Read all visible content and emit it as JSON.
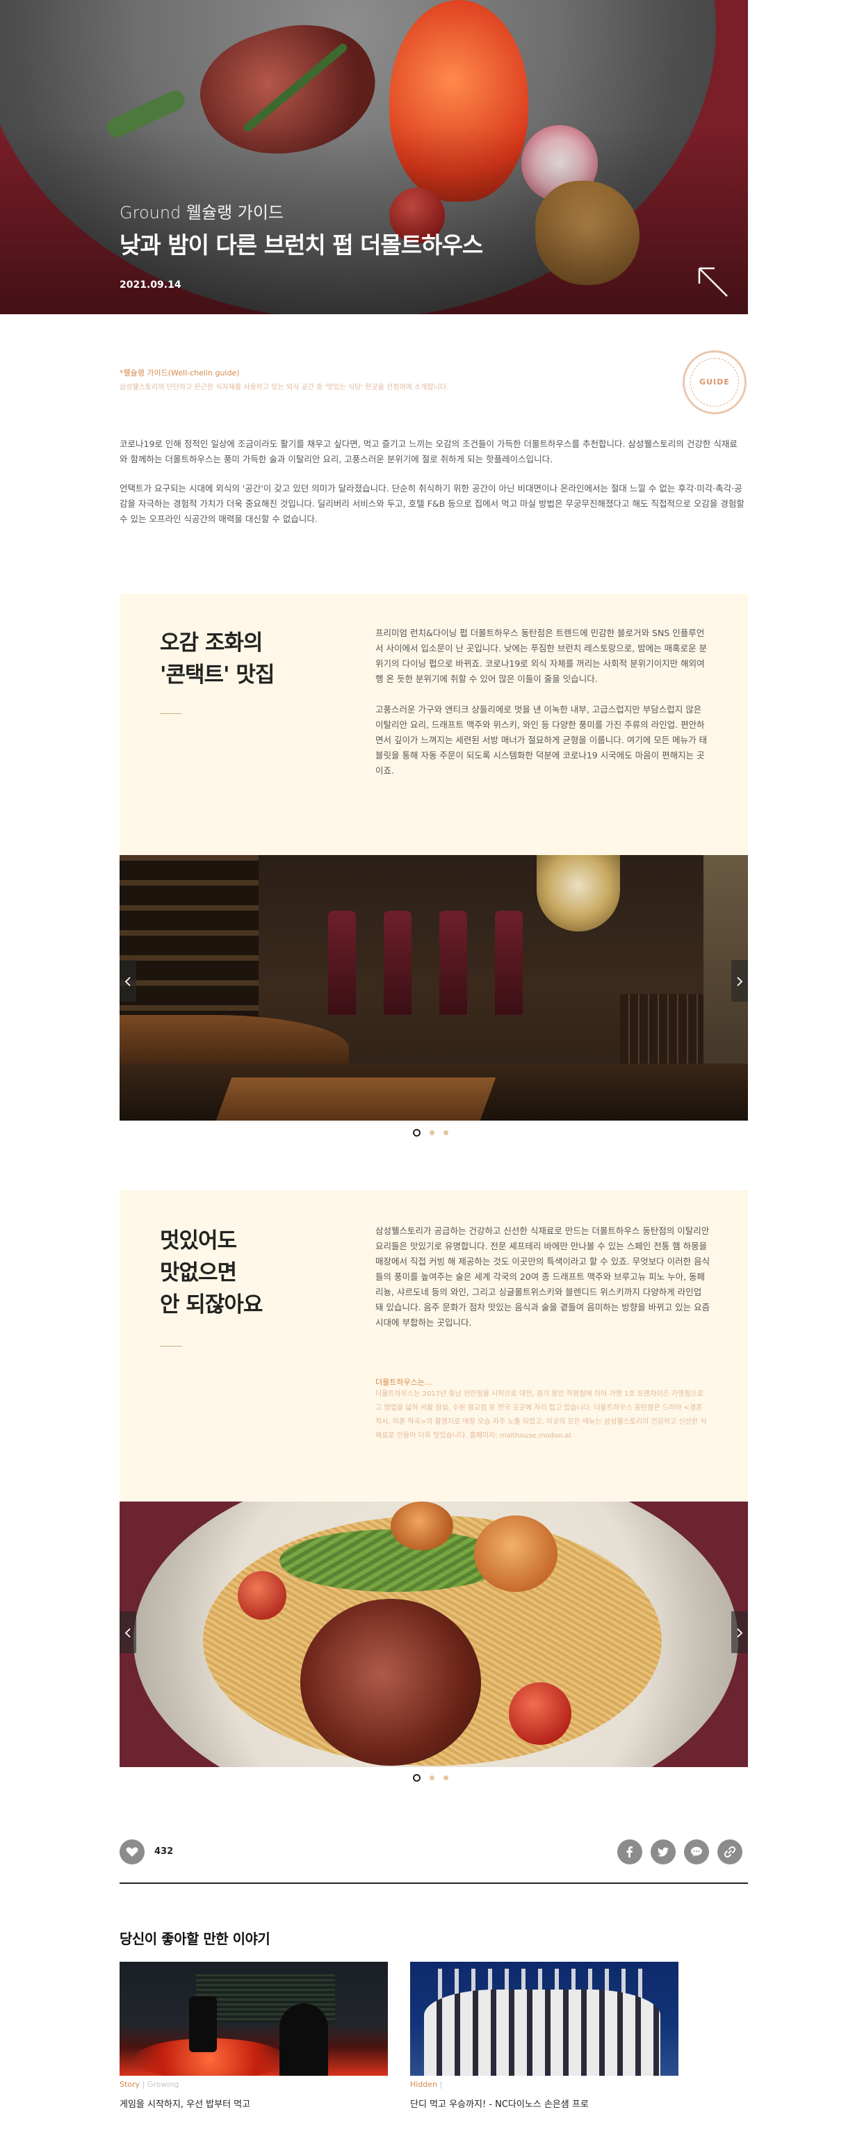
{
  "hero": {
    "category": "Ground 웰슐랭 가이드",
    "title": "낮과 밤이 다른 브런치 펍 더몰트하우스",
    "date": "2021.09.14",
    "arrow_icon": "arrow-up-left-icon"
  },
  "intro": {
    "label": "*웰슐랭 가이드(Well-chelin guide)",
    "note": "삼성웰스토리의 단단하고 은근한 식자재를 사용하고 있는 외식 공간 중 '맛있는 식당' 한곳을 선정하여 소개합니다.",
    "badge": "GUIDE",
    "p1": "코로나19로 인해 정적인 일상에 조금이라도 활기를 채우고 싶다면, 먹고 즐기고 느끼는 오감의 조건들이 가득한 더몰트하우스를 추천합니다. 삼성웰스토리의 건강한 식재료와 함께하는 더몰트하우스는 풍미 가득한 술과 이탈리안 요리, 고풍스러운 분위기에 절로 취하게 되는 핫플레이스입니다.",
    "p2": "언택트가 요구되는 시대에 외식의 '공간'이 갖고 있던 의미가 달라졌습니다. 단순히 취식하기 위한 공간이 아닌 비대면이나 온라인에서는 절대 느낄 수 없는 후각·미각·촉각·공감을 자극하는 경험적 가치가 더욱 중요해진 것입니다. 딜리버리 서비스와 두고, 호텔 F&B 등으로 집에서 먹고 마실 방법은 무궁무진해졌다고 해도 직접적으로 오감을 경험할 수 있는 오프라인 식공간의 매력을 대신할 수 없습니다."
  },
  "section1": {
    "title_line1": "오감 조화의",
    "title_line2": "'콘택트' 맛집",
    "text1": "프리미엄 런치&다이닝 펍 더몰트하우스 동탄점은 트렌드에 민감한 블로거와 SNS 인플루언서 사이에서 입소문이 난 곳입니다. 낮에는 푸짐한 브런치 레스토랑으로, 밤에는 매혹로운 분위기의 다이닝 펍으로 바뀌죠. 코로나19로 외식 자체를 꺼리는 사회적 분위기이지만 해외여행 온 듯한 분위기에 취할 수 있어 많은 이들이 줄을 잇습니다.",
    "text2": "고풍스러운 가구와 앤티크 샹들리에로 멋을 낸 이녹한 내부, 고급스럽지만 부담스럽지 않은 이탈리안 요리, 드래프트 맥주와 위스키, 와인 등 다양한 풍미를 가진 주류의 라인업. 편안하면서 깊이가 느껴지는 세련된 서방 매너가 절묘하게 균형을 이룹니다. 여기에 모든 메뉴가 태블릿을 통해 자동 주문이 되도록 시스템화한 덕분에 코로나19 시국에도 마음이 편해지는 곳이죠."
  },
  "section2": {
    "title_line1": "멋있어도",
    "title_line2": "맛없으면",
    "title_line3": "안 되잖아요",
    "text1": "삼성웰스토리가 공급하는 건강하고 신선한 식재료로 만드는 더몰트하우스 동탄점의 이탈리안 요리들은 맛있기로 유명합니다. 전문 셰프테리 바에만 만나볼 수 있는 스페인 전통 햄 하몽을 매장에서 직접 커빙 해 제공하는 것도 이곳만의 특색이라고 할 수 있죠. 무엇보다 이러한 음식들의 풍미를 높여주는 술은 세계 각국의 20여 종 드래프트 맥주와 브루고뉴 피노 누아, 동페리뇽, 샤르도네 등의 와인, 그리고 싱글몰트위스키와 블렌디드 위스키까지 다양하게 라인업 돼 있습니다. 음주 문화가 점차 맛있는 음식과 술을 곁들여 음미하는 방향을 바뀌고 있는 요즘 시대에 부합하는 곳입니다.",
    "note_label": "더몰트하우스는...",
    "note_text": "더몰트하우스는 2017년 중남 천안점을 시작으로 대전, 경기 용인 직영점에 이어 가맹 1호 프랜차이즈 가맹점으로 고 영업을 넓혀 서울 잠실, 수원 광교점 등 전국 곳곳에 자리 잡고 있습니다. 더몰트하우스 동탄점은 드라마 <결혼 작사, 이혼 작곡>의 촬영지로 매장 모습 자주 노출 되었고, 이곳의 모든 메뉴는 삼성웰스토리의 건강하고 신선한 식재료로 만들어 더욱 맛있습니다. 홈페이지: malthouse.modoo.at"
  },
  "likes": {
    "count": "432",
    "heart_icon": "heart-icon"
  },
  "share": [
    {
      "name": "facebook-icon",
      "label": "f"
    },
    {
      "name": "twitter-icon",
      "label": "t"
    },
    {
      "name": "talk-icon",
      "label": "talk"
    },
    {
      "name": "link-icon",
      "label": "link"
    }
  ],
  "recommend": {
    "title": "당신이 좋아할 만한 이야기",
    "cards": [
      {
        "category": "Story",
        "sub": "Growing",
        "label": "게임을 시작하지, 우선 밥부터 먹고"
      },
      {
        "category": "Hidden",
        "sub": "",
        "label": "단디 먹고 우승까지! - NC다이노스 손은샘 프로"
      }
    ]
  },
  "colors": {
    "accent": "#d4894b",
    "cream": "#fff8e8",
    "hero_red": "#7a1e28",
    "icon_gray": "#8c8c8c"
  }
}
